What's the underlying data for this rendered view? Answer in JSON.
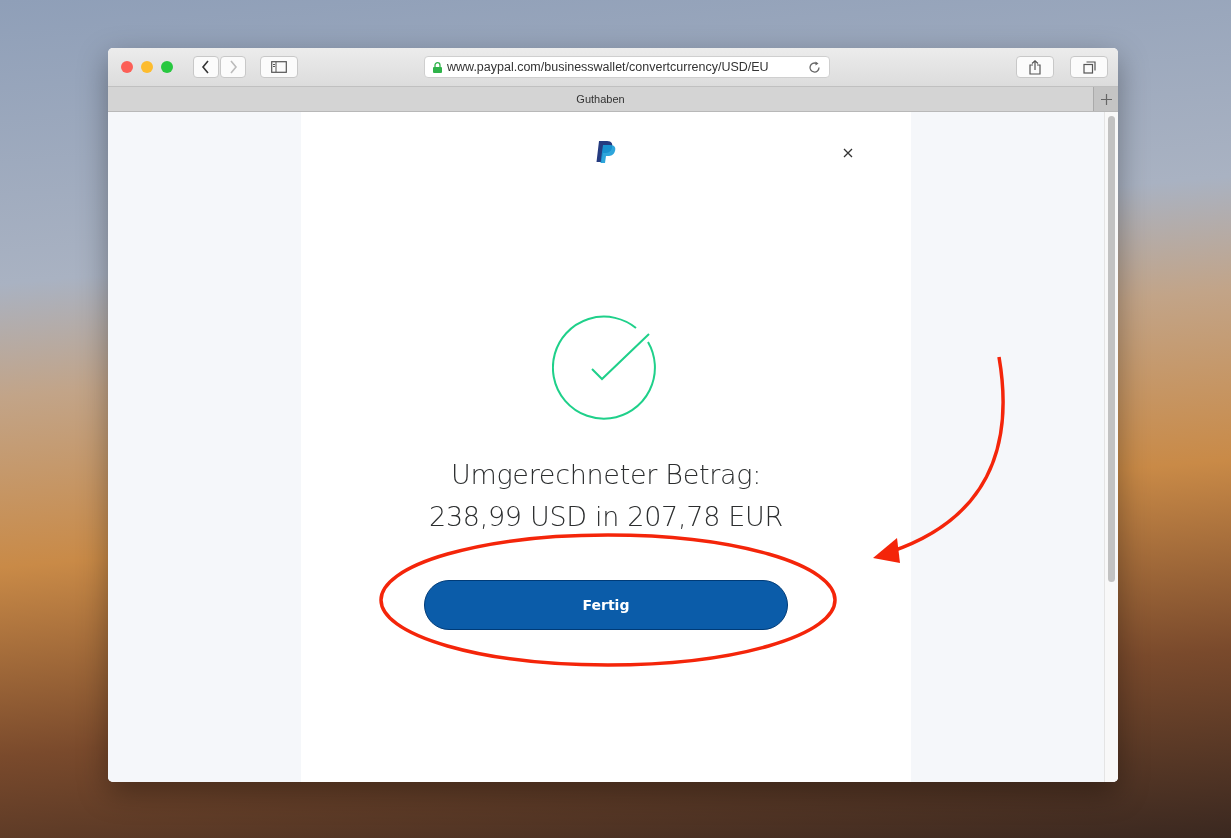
{
  "browser": {
    "url": "www.paypal.com/businesswallet/convertcurrency/USD/EU",
    "secure": true,
    "tab_title": "Guthaben",
    "nav_buttons": [
      {
        "kind": "back",
        "disabled": false
      },
      {
        "kind": "forward",
        "disabled": true
      }
    ]
  },
  "dialog": {
    "heading": "Umgerechneter Betrag:",
    "amount": "238,99 USD in 207,78 EUR",
    "button": "Fertig"
  }
}
